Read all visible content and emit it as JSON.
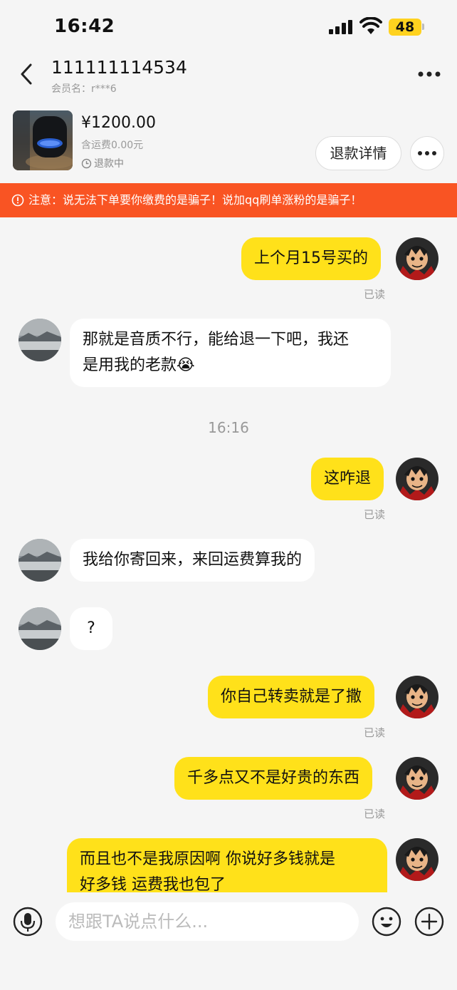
{
  "status_bar": {
    "time": "16:42",
    "battery": "48"
  },
  "header": {
    "name": "111111114534",
    "member": "会员名：r***6"
  },
  "product": {
    "price": "¥1200.00",
    "shipping": "含运费0.00元",
    "status": "退款中",
    "refund_button": "退款详情"
  },
  "warning": {
    "text": "注意：说无法下单要你缴费的是骗子！说加qq刷单涨粉的是骗子！"
  },
  "messages": [
    {
      "text": "上个月15号买的",
      "read": "已读"
    },
    {
      "text_line1": "那就是音质不行，能给退一下吧，我还",
      "text_line2": "是用我的老款😭"
    },
    {
      "timestamp": "16:16"
    },
    {
      "text": "这咋退",
      "read": "已读"
    },
    {
      "text": "我给你寄回来，来回运费算我的"
    },
    {
      "text": "?"
    },
    {
      "text": "你自己转卖就是了撒",
      "read": "已读"
    },
    {
      "text": "千多点又不是好贵的东西",
      "read": "已读"
    },
    {
      "text_line1": "而且也不是我原因啊 你说好多钱就是",
      "text_line2": "好多钱 运费我也包了"
    }
  ],
  "input": {
    "placeholder": "想跟TA说点什么..."
  },
  "colors": {
    "accent_yellow": "#ffe11a",
    "warning_orange": "#f95423",
    "background": "#f5f5f5"
  }
}
